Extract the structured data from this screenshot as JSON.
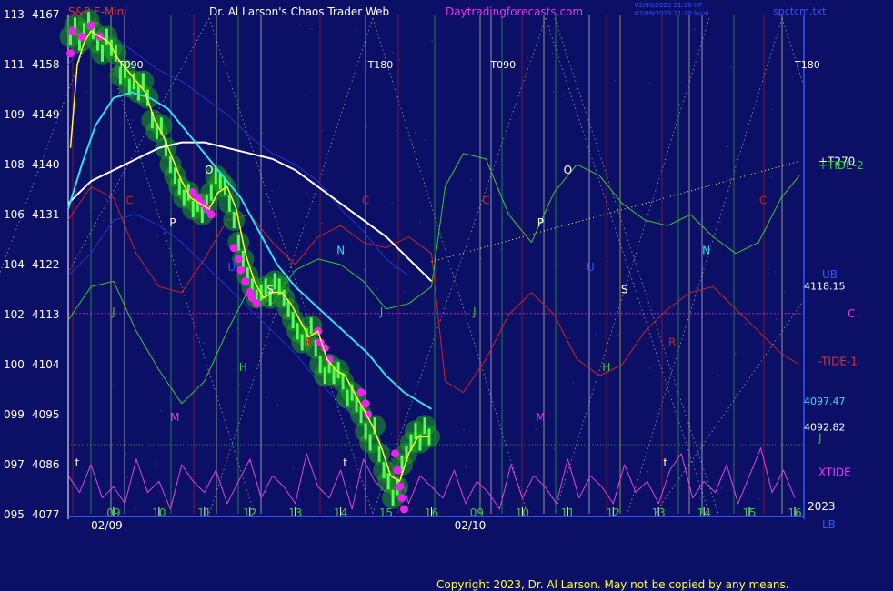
{
  "header": {
    "symbol": "S&P E-Mini",
    "title": "Dr. Al Larson's Chaos Trader Web",
    "site": "Daytradingforecasts.com",
    "stamp1": "02/09/2023 21:20 UP",
    "stamp2": "02/09/2023 21:20 local",
    "file": "spctcm.txt"
  },
  "copyright": "Copyright 2023, Dr. Al Larson. May not be copied by any means.",
  "colors": {
    "background": "#0b1066",
    "price_bars": "#22cc22",
    "fast_avg": "#ffff33",
    "mid_avg": "#33ddee",
    "slow_avg": "#ffffff",
    "tide1": "#cc2222",
    "tide2": "#33cc33",
    "xtide": "#dd44dd",
    "text_red": "#dd3333",
    "text_magenta": "#ee33ee"
  },
  "chart_data": {
    "type": "line",
    "ylabels_left": [
      {
        "code": "113",
        "price": 4167
      },
      {
        "code": "111",
        "price": 4158
      },
      {
        "code": "109",
        "price": 4149
      },
      {
        "code": "108",
        "price": 4140
      },
      {
        "code": "106",
        "price": 4131
      },
      {
        "code": "104",
        "price": 4122
      },
      {
        "code": "102",
        "price": 4113
      },
      {
        "code": "100",
        "price": 4104
      },
      {
        "code": "099",
        "price": 4095
      },
      {
        "code": "097",
        "price": 4086
      },
      {
        "code": "095",
        "price": 4077
      }
    ],
    "ylim": [
      4077,
      4167
    ],
    "hour_labels": [
      {
        "label": "09",
        "x": 9
      },
      {
        "label": "10",
        "x": 10
      },
      {
        "label": "11",
        "x": 11
      },
      {
        "label": "12",
        "x": 12
      },
      {
        "label": "13",
        "x": 13
      },
      {
        "label": "14",
        "x": 14
      },
      {
        "label": "15",
        "x": 15
      },
      {
        "label": "16",
        "x": 16
      },
      {
        "label": "09",
        "x": 17
      },
      {
        "label": "10",
        "x": 18
      },
      {
        "label": "11",
        "x": 19
      },
      {
        "label": "12",
        "x": 20
      },
      {
        "label": "13",
        "x": 21
      },
      {
        "label": "14",
        "x": 22
      },
      {
        "label": "15",
        "x": 23
      },
      {
        "label": "16",
        "x": 24
      }
    ],
    "date_labels": [
      {
        "label": "02/09",
        "x": 8.85
      },
      {
        "label": "02/10",
        "x": 16.85
      }
    ],
    "xlim": [
      8,
      24.2
    ],
    "price_levels": [
      {
        "label": "4118.15",
        "price": 4118.15
      },
      {
        "label": "4097.47",
        "price": 4097.47
      },
      {
        "label": "4092.82",
        "price": 4092.82
      }
    ],
    "right_labels": [
      {
        "text": "+T270",
        "price": 4140.6,
        "color": "#ffffff"
      },
      {
        "text": "+TIDE-2",
        "price": 4139.8,
        "color": "#33cc33"
      },
      {
        "text": "UB",
        "price": 4120.2,
        "color": "#3355ff"
      },
      {
        "text": "C",
        "price": 4113.2,
        "color": "#ee33ee"
      },
      {
        "text": "-TIDE-1",
        "price": 4104.6,
        "color": "#dd3333"
      },
      {
        "text": "J",
        "price": 4090.8,
        "color": "#33cc33"
      },
      {
        "text": "XTIDE",
        "price": 4084.6,
        "color": "#ee33ee"
      },
      {
        "text": "2023",
        "price": 4078.5,
        "color": "#ffffff"
      },
      {
        "text": "LB",
        "price": 4075.2,
        "color": "#3355ff"
      }
    ],
    "t_labels": [
      {
        "text": "T090",
        "x": 9.1,
        "price": 4158
      },
      {
        "text": "T180",
        "x": 14.6,
        "price": 4158
      },
      {
        "text": "T090",
        "x": 17.3,
        "price": 4158
      },
      {
        "text": "T180",
        "x": 24.0,
        "price": 4158
      }
    ],
    "planet_labels": [
      {
        "text": "C",
        "x": 9.35,
        "price": 4133.5,
        "color": "#cc2222"
      },
      {
        "text": "P",
        "x": 10.3,
        "price": 4129.5,
        "color": "#ffffff"
      },
      {
        "text": "O",
        "x": 11.1,
        "price": 4139,
        "color": "#ffffff"
      },
      {
        "text": "U",
        "x": 11.6,
        "price": 4121.5,
        "color": "#3355ff"
      },
      {
        "text": "J",
        "x": 9.0,
        "price": 4113.5,
        "color": "#33cc33"
      },
      {
        "text": "H",
        "x": 11.85,
        "price": 4103.5,
        "color": "#33cc33"
      },
      {
        "text": "M",
        "x": 10.35,
        "price": 4094.5,
        "color": "#ee33ee"
      },
      {
        "text": "S",
        "x": 12.45,
        "price": 4117.5,
        "color": "#ffffff"
      },
      {
        "text": "R",
        "x": 13.3,
        "price": 4108,
        "color": "#cc2222"
      },
      {
        "text": "N",
        "x": 14.0,
        "price": 4124.5,
        "color": "#33ddee"
      },
      {
        "text": "J",
        "x": 14.9,
        "price": 4113.5,
        "color": "#33cc33"
      },
      {
        "text": "C",
        "x": 14.55,
        "price": 4133.5,
        "color": "#cc2222"
      },
      {
        "text": "C",
        "x": 17.2,
        "price": 4133.5,
        "color": "#cc2222"
      },
      {
        "text": "J",
        "x": 16.95,
        "price": 4113.5,
        "color": "#33cc33"
      },
      {
        "text": "P",
        "x": 18.4,
        "price": 4129.5,
        "color": "#ffffff"
      },
      {
        "text": "O",
        "x": 19.0,
        "price": 4139,
        "color": "#ffffff"
      },
      {
        "text": "M",
        "x": 18.4,
        "price": 4094.5,
        "color": "#ee33ee"
      },
      {
        "text": "U",
        "x": 19.5,
        "price": 4121.5,
        "color": "#3355ff"
      },
      {
        "text": "S",
        "x": 20.25,
        "price": 4117.5,
        "color": "#ffffff"
      },
      {
        "text": "H",
        "x": 19.85,
        "price": 4103.5,
        "color": "#33cc33"
      },
      {
        "text": "R",
        "x": 21.3,
        "price": 4108,
        "color": "#cc2222"
      },
      {
        "text": "N",
        "x": 22.05,
        "price": 4124.5,
        "color": "#33ddee"
      },
      {
        "text": "C",
        "x": 23.3,
        "price": 4133.5,
        "color": "#cc2222"
      },
      {
        "text": "t",
        "x": 8.2,
        "price": 4086.3,
        "color": "#ffffff"
      },
      {
        "text": "t",
        "x": 14.1,
        "price": 4086.3,
        "color": "#ffffff"
      },
      {
        "text": "t",
        "x": 21.15,
        "price": 4086.3,
        "color": "#ffffff"
      }
    ],
    "series": [
      {
        "name": "price",
        "x": [
          8.05,
          8.15,
          8.25,
          8.35,
          8.45,
          8.55,
          8.65,
          8.75,
          8.85,
          8.95,
          9.05,
          9.15,
          9.25,
          9.35,
          9.45,
          9.55,
          9.65,
          9.75,
          9.85,
          9.95,
          10.05,
          10.15,
          10.25,
          10.35,
          10.45,
          10.55,
          10.65,
          10.75,
          10.85,
          10.95,
          11.05,
          11.15,
          11.25,
          11.35,
          11.45,
          11.55,
          11.65,
          11.75,
          11.85,
          11.95,
          12.05,
          12.15,
          12.25,
          12.35,
          12.45,
          12.55,
          12.65,
          12.75,
          12.85,
          12.95,
          13.05,
          13.15,
          13.25,
          13.35,
          13.45,
          13.55,
          13.65,
          13.75,
          13.85,
          13.95,
          14.05,
          14.15,
          14.25,
          14.35,
          14.45,
          14.55,
          14.65,
          14.75,
          14.85,
          14.95,
          15.05,
          15.15,
          15.25,
          15.35,
          15.45,
          15.55,
          15.65,
          15.75,
          15.85,
          15.95
        ],
        "values": [
          4163,
          4165,
          4162,
          4164,
          4166,
          4164,
          4162,
          4160,
          4163,
          4161,
          4160,
          4156,
          4157,
          4154,
          4155,
          4153,
          4155,
          4152,
          4148,
          4146,
          4147,
          4143,
          4140,
          4138,
          4136,
          4134,
          4135,
          4132,
          4133,
          4131,
          4133,
          4135,
          4138,
          4137,
          4136,
          4133,
          4130,
          4126,
          4123,
          4120,
          4118,
          4116,
          4117,
          4118,
          4116,
          4119,
          4118,
          4116,
          4114,
          4112,
          4110,
          4108,
          4109,
          4111,
          4107,
          4104,
          4102,
          4104,
          4102,
          4103,
          4101,
          4098,
          4099,
          4097,
          4095,
          4092,
          4090,
          4093,
          4088,
          4085,
          4083,
          4080,
          4082,
          4086,
          4088,
          4090,
          4092,
          4090,
          4093,
          4091
        ]
      },
      {
        "name": "fast",
        "x": [
          8.05,
          8.2,
          8.35,
          8.5,
          8.7,
          8.9,
          9.1,
          9.3,
          9.5,
          9.7,
          9.9,
          10.1,
          10.3,
          10.5,
          10.7,
          10.9,
          11.1,
          11.3,
          11.5,
          11.7,
          11.9,
          12.1,
          12.3,
          12.5,
          12.7,
          12.9,
          13.1,
          13.3,
          13.5,
          13.7,
          13.9,
          14.1,
          14.3,
          14.5,
          14.7,
          14.9,
          15.1,
          15.3,
          15.5,
          15.7,
          15.95
        ],
        "values": [
          4143,
          4158,
          4162,
          4164,
          4163,
          4162,
          4159,
          4157,
          4155,
          4153,
          4148,
          4145,
          4141,
          4137,
          4134,
          4133,
          4132,
          4135,
          4136,
          4132,
          4124,
          4119,
          4116,
          4117,
          4117,
          4115,
          4112,
          4109,
          4110,
          4105,
          4103,
          4102,
          4099,
          4096,
          4093,
          4089,
          4084,
          4083,
          4088,
          4091,
          4091
        ]
      },
      {
        "name": "mid",
        "x": [
          8.0,
          8.3,
          8.6,
          9.0,
          9.4,
          9.8,
          10.2,
          10.6,
          11.0,
          11.4,
          11.8,
          12.2,
          12.6,
          13.0,
          13.4,
          13.8,
          14.2,
          14.6,
          15.0,
          15.4,
          15.8,
          16.0
        ],
        "values": [
          4132,
          4140,
          4147,
          4152,
          4153,
          4152,
          4150,
          4146,
          4142,
          4138,
          4134,
          4128,
          4122,
          4118,
          4115,
          4112,
          4109,
          4106,
          4102,
          4099,
          4097,
          4096
        ]
      },
      {
        "name": "slow",
        "x": [
          8.0,
          8.5,
          9.0,
          9.5,
          10.0,
          10.5,
          11.0,
          11.5,
          12.0,
          12.5,
          13.0,
          13.5,
          14.0,
          14.5,
          15.0,
          15.5,
          16.0
        ],
        "values": [
          4133,
          4137,
          4139,
          4141,
          4143,
          4144,
          4144,
          4143,
          4142,
          4141,
          4139,
          4136,
          4133,
          4130,
          4127,
          4123,
          4119
        ]
      },
      {
        "name": "TIDE-2",
        "x": [
          8.0,
          8.5,
          9.0,
          9.5,
          10.0,
          10.5,
          11.0,
          11.5,
          12.0,
          12.5,
          13.0,
          13.5,
          14.0,
          14.5,
          15.0,
          15.5,
          16.0,
          16.3,
          16.7,
          17.2,
          17.7,
          18.2,
          18.7,
          19.2,
          19.7,
          20.2,
          20.7,
          21.2,
          21.7,
          22.2,
          22.7,
          23.2,
          23.7,
          24.1
        ],
        "values": [
          4112,
          4118,
          4119,
          4110,
          4103,
          4097,
          4101,
          4110,
          4118,
          4115,
          4121,
          4123,
          4122,
          4119,
          4114,
          4115,
          4118,
          4136,
          4142,
          4141,
          4131,
          4126,
          4135,
          4140,
          4138,
          4133,
          4130,
          4129,
          4131,
          4127,
          4124,
          4126,
          4134,
          4138
        ]
      },
      {
        "name": "TIDE-1",
        "x": [
          8.0,
          8.5,
          9.0,
          9.5,
          10.0,
          10.5,
          11.0,
          11.5,
          12.0,
          12.5,
          13.0,
          13.5,
          14.0,
          14.5,
          15.0,
          15.5,
          16.0,
          16.3,
          16.7,
          17.2,
          17.7,
          18.2,
          18.7,
          19.2,
          19.7,
          20.2,
          20.7,
          21.2,
          21.7,
          22.2,
          22.7,
          23.2,
          23.7,
          24.1
        ],
        "values": [
          4130,
          4136,
          4134,
          4124,
          4118,
          4117,
          4123,
          4130,
          4131,
          4126,
          4122,
          4127,
          4129,
          4126,
          4125,
          4127,
          4124,
          4101,
          4099,
          4105,
          4113,
          4117,
          4113,
          4105,
          4102,
          4104,
          4110,
          4114,
          4117,
          4118,
          4114,
          4110,
          4106,
          4104
        ]
      },
      {
        "name": "Tplus270",
        "x": [
          16.0,
          24.1
        ],
        "values": [
          4122.5,
          4140.6
        ]
      },
      {
        "name": "UB",
        "x": [
          8.0,
          8.5,
          9.0,
          9.5,
          10.0,
          10.5,
          11.0,
          11.5,
          12.0,
          12.5,
          13.0,
          13.5,
          14.0,
          14.5,
          15.0,
          15.5
        ],
        "values": [
          4158,
          4163,
          4163,
          4160,
          4157,
          4155,
          4152,
          4149,
          4145,
          4142,
          4140,
          4137,
          4132,
          4128,
          4123,
          4120
        ]
      },
      {
        "name": "LB",
        "x": [
          8.0,
          8.5,
          9.0,
          9.5,
          10.0,
          10.5,
          11.0,
          11.5,
          12.0,
          12.5,
          13.0,
          13.5,
          14.0,
          14.5,
          15.0,
          15.5
        ],
        "values": [
          4120,
          4124,
          4130,
          4131,
          4129,
          4126,
          4122,
          4118,
          4114,
          4110,
          4106,
          4101,
          4097,
          4093,
          4089,
          4087
        ]
      }
    ],
    "magenta_dots": {
      "x": [
        8.05,
        8.1,
        8.3,
        8.5,
        8.7,
        10.75,
        10.85,
        10.95,
        11.05,
        11.15,
        11.65,
        11.75,
        11.8,
        11.9,
        12.0,
        12.05,
        12.15,
        13.5,
        13.55,
        13.65,
        13.75,
        14.45,
        14.55,
        14.6,
        15.2,
        15.25,
        15.3,
        15.35,
        15.4
      ],
      "values": [
        4160,
        4164,
        4163,
        4165,
        4163,
        4135,
        4134,
        4133,
        4132,
        4131,
        4125,
        4123,
        4121,
        4119,
        4117,
        4116,
        4115,
        4110,
        4108,
        4107,
        4105,
        4099,
        4097,
        4095,
        4088,
        4085,
        4082,
        4080,
        4078
      ]
    },
    "xtide": {
      "x": [
        8.0,
        8.25,
        8.5,
        8.75,
        9.0,
        9.25,
        9.5,
        9.75,
        10.0,
        10.25,
        10.5,
        10.75,
        11.0,
        11.25,
        11.5,
        11.75,
        12.0,
        12.25,
        12.5,
        12.75,
        13.0,
        13.25,
        13.5,
        13.75,
        14.0,
        14.25,
        14.5,
        14.75,
        15.0,
        15.25,
        15.5,
        15.75,
        16.0,
        16.25,
        16.5,
        16.75,
        17.0,
        17.25,
        17.5,
        17.75,
        18.0,
        18.25,
        18.5,
        18.75,
        19.0,
        19.25,
        19.5,
        19.75,
        20.0,
        20.25,
        20.5,
        20.75,
        21.0,
        21.25,
        21.5,
        21.75,
        22.0,
        22.25,
        22.5,
        22.75,
        23.0,
        23.25,
        23.5,
        23.75,
        24.0
      ],
      "values": [
        4084,
        4081,
        4086,
        4080,
        4082,
        4079,
        4087,
        4081,
        4083,
        4078,
        4086,
        4083,
        4081,
        4085,
        4079,
        4083,
        4087,
        4080,
        4084,
        4082,
        4079,
        4088,
        4082,
        4080,
        4085,
        4078,
        4087,
        4083,
        4081,
        4086,
        4079,
        4084,
        4082,
        4080,
        4085,
        4079,
        4083,
        4081,
        4078,
        4086,
        4080,
        4084,
        4082,
        4079,
        4087,
        4080,
        4084,
        4082,
        4079,
        4086,
        4081,
        4083,
        4079,
        4085,
        4088,
        4080,
        4083,
        4081,
        4086,
        4079,
        4084,
        4089,
        4081,
        4085,
        4080
      ]
    }
  }
}
